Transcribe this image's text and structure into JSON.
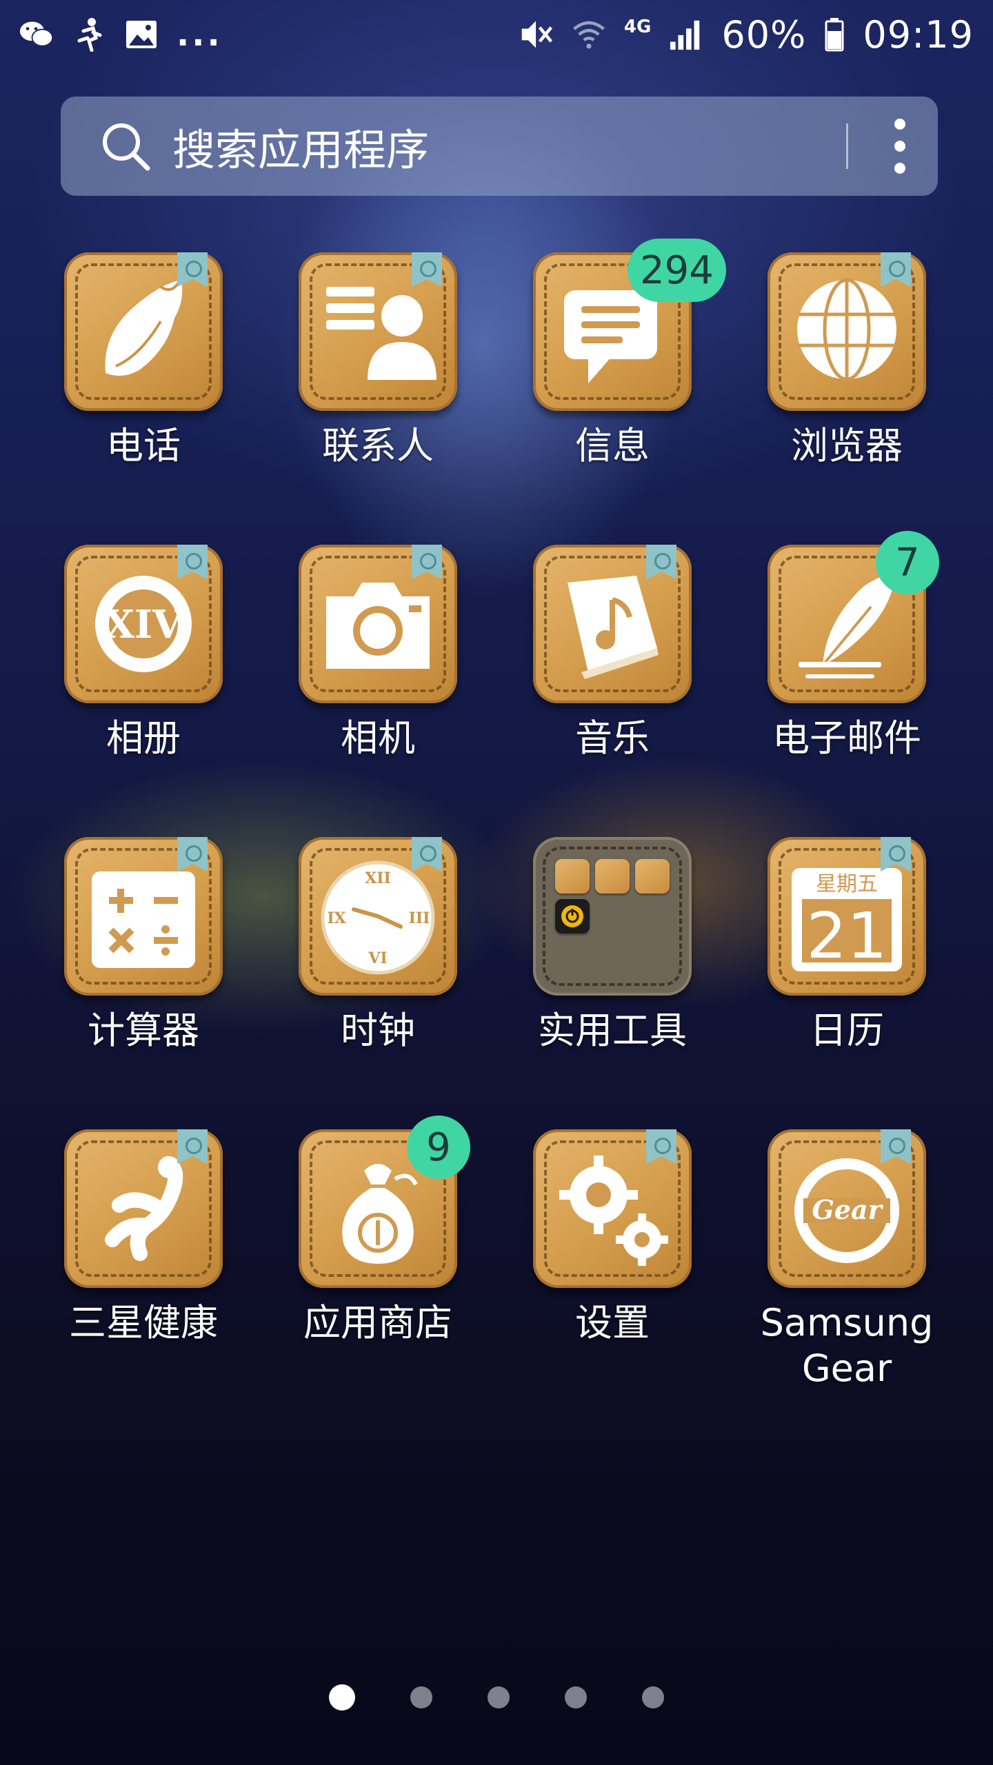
{
  "status_bar": {
    "left_icons": [
      "wechat-icon",
      "runner-icon",
      "gallery-icon"
    ],
    "overflow": "...",
    "network_type": "4G",
    "battery_percent": "60%",
    "time": "09:19"
  },
  "search": {
    "placeholder": "搜索应用程序"
  },
  "apps": [
    {
      "label": "电话",
      "icon": "conch-shell-icon"
    },
    {
      "label": "联系人",
      "icon": "contact-card-icon"
    },
    {
      "label": "信息",
      "icon": "message-bubble-icon",
      "badge": "294"
    },
    {
      "label": "浏览器",
      "icon": "globe-icon"
    },
    {
      "label": "相册",
      "icon": "xiv-emblem-icon"
    },
    {
      "label": "相机",
      "icon": "camera-icon"
    },
    {
      "label": "音乐",
      "icon": "music-book-icon"
    },
    {
      "label": "电子邮件",
      "icon": "feather-quill-icon",
      "badge": "7"
    },
    {
      "label": "计算器",
      "icon": "calculator-icon"
    },
    {
      "label": "时钟",
      "icon": "clock-icon",
      "clock_numerals": [
        "XII",
        "III",
        "VI",
        "IX"
      ]
    },
    {
      "label": "实用工具",
      "icon": "folder-icon"
    },
    {
      "label": "日历",
      "icon": "calendar-icon",
      "weekday": "星期五",
      "day": "21"
    },
    {
      "label": "三星健康",
      "icon": "health-figure-icon"
    },
    {
      "label": "应用商店",
      "icon": "money-bag-icon",
      "badge": "9"
    },
    {
      "label": "设置",
      "icon": "gears-icon"
    },
    {
      "label": "Samsung Gear",
      "icon": "gear-emblem-icon"
    }
  ],
  "page_indicator": {
    "pages": 5,
    "active": 1
  },
  "colors": {
    "badge": "#3fd6a4",
    "icon_base": "#d9a456"
  }
}
